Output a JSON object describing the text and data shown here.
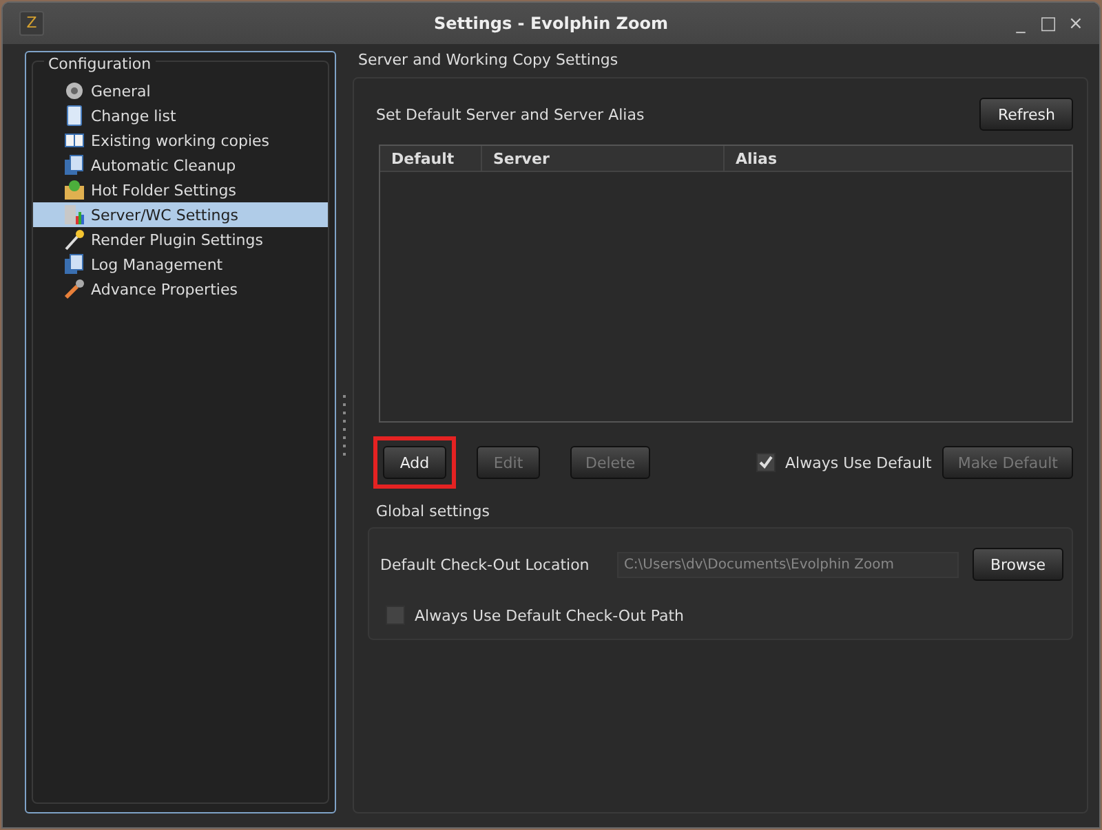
{
  "window": {
    "logo": "Z",
    "title": "Settings - Evolphin Zoom",
    "controls": [
      "_",
      "□",
      "×"
    ]
  },
  "sidebar": {
    "title": "Configuration",
    "items": [
      {
        "label": "General",
        "selected": false
      },
      {
        "label": "Change list",
        "selected": false
      },
      {
        "label": "Existing working copies",
        "selected": false
      },
      {
        "label": "Automatic Cleanup",
        "selected": false
      },
      {
        "label": "Hot Folder Settings",
        "selected": false
      },
      {
        "label": "Server/WC Settings",
        "selected": true
      },
      {
        "label": "Render Plugin Settings",
        "selected": false
      },
      {
        "label": "Log Management",
        "selected": false
      },
      {
        "label": "Advance Properties",
        "selected": false
      }
    ]
  },
  "server_section": {
    "title": "Server and Working Copy Settings",
    "subtitle": "Set Default Server and Server Alias",
    "refresh_button": {
      "label": "Refresh",
      "disabled": false
    },
    "table": {
      "columns": [
        "Default",
        "Server",
        "Alias"
      ]
    },
    "buttons": [
      {
        "label": "Add",
        "disabled": false,
        "highlighted": true
      },
      {
        "label": "Edit",
        "disabled": true,
        "highlighted": false
      },
      {
        "label": "Delete",
        "disabled": true,
        "highlighted": false
      }
    ],
    "always_use_default": {
      "label": "Always Use Default",
      "checked": true
    },
    "make_default_button": {
      "label": "Make Default",
      "disabled": true
    }
  },
  "global_settings": {
    "title": "Global settings",
    "location_label": "Default Check-Out Location",
    "location_value": "C:\\Users\\dv\\Documents\\Evolphin Zoom",
    "location_disabled": true,
    "browse_button": {
      "label": "Browse",
      "disabled": false
    },
    "always_use_path": {
      "label": "Always Use Default Check-Out Path",
      "checked": false
    }
  }
}
